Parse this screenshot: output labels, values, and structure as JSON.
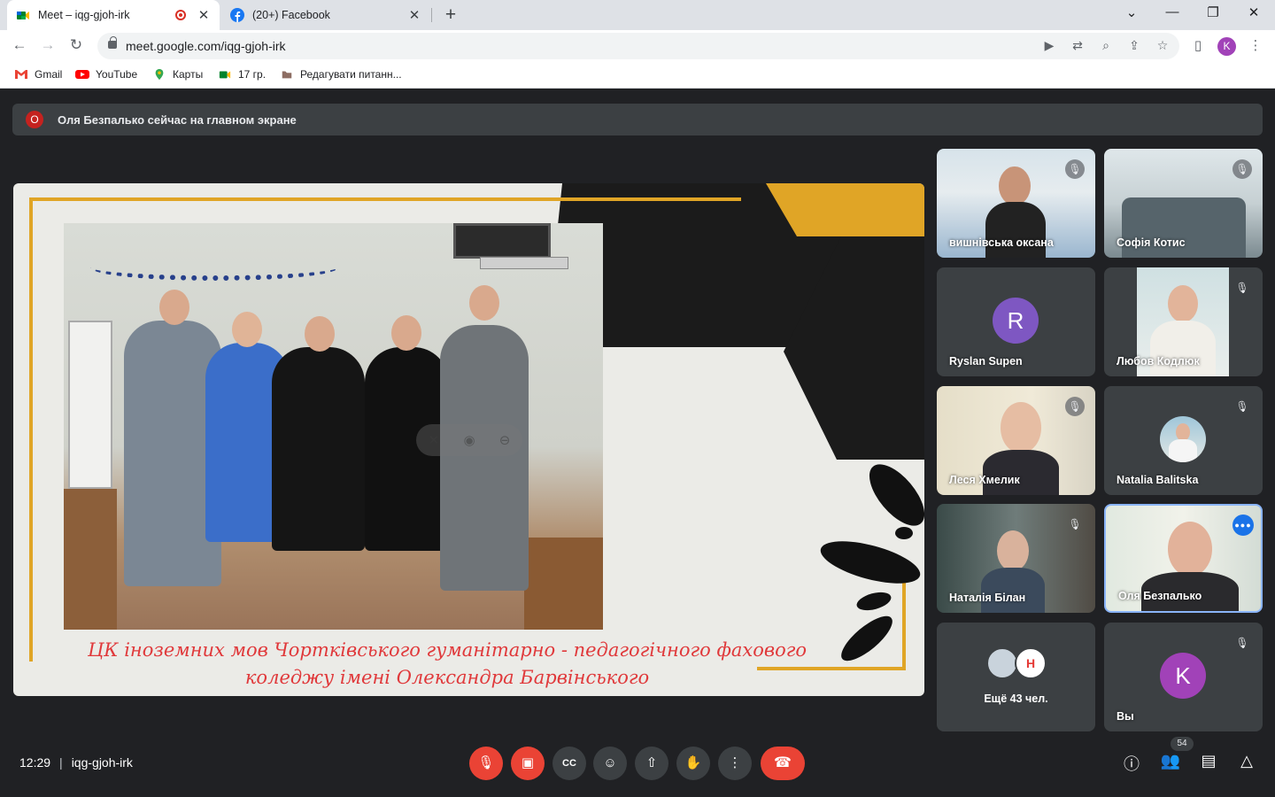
{
  "browser": {
    "tabs": [
      {
        "title": "Meet – iqg-gjoh-irk",
        "close": "✕"
      },
      {
        "title": "(20+) Facebook",
        "close": "✕"
      }
    ],
    "new_tab": "+",
    "window_controls": {
      "dropdown": "⌄",
      "minimize": "—",
      "restore": "❐",
      "close": "✕"
    },
    "url": "meet.google.com/iqg-gjoh-irk",
    "profile_letter": "K",
    "bookmarks": [
      {
        "label": "Gmail",
        "icon": "gmail-icon"
      },
      {
        "label": "YouTube",
        "icon": "youtube-icon"
      },
      {
        "label": "Карты",
        "icon": "maps-pin-icon"
      },
      {
        "label": "17 гр.",
        "icon": "meet-icon"
      },
      {
        "label": "Редагувати питанн...",
        "icon": "folder-icon"
      }
    ]
  },
  "meet": {
    "banner": {
      "initial": "О",
      "text": "Оля Безпалько сейчас на главном экране"
    },
    "presentation": {
      "caption_line1": "ЦК іноземних мов Чортківського гуманітарно - педагогічного фахового",
      "caption_line2": "коледжу імені Олександра Барвінського",
      "colors": {
        "accent_yellow": "#e0a526",
        "black": "#1b1b1b",
        "caption_red": "#e0393b"
      }
    },
    "participants": [
      {
        "name": "вишнівська оксана",
        "muted": true
      },
      {
        "name": "Софія Котис",
        "muted": true
      },
      {
        "name": "Ryslan Supen",
        "initial": "R",
        "avatar_color": "#7e57c2",
        "muted": false
      },
      {
        "name": "Любов Кодлюк",
        "muted": true
      },
      {
        "name": "Леся Хмелик",
        "muted": true
      },
      {
        "name": "Natalia Balitska",
        "muted": true
      },
      {
        "name": "Наталія Білан",
        "muted": true
      },
      {
        "name": "Оля Безпалько",
        "speaking": true
      },
      {
        "more_label": "Ещё 43 чел."
      },
      {
        "name": "Вы",
        "initial": "K",
        "avatar_color": "#a142b8",
        "muted": true
      }
    ],
    "bottom": {
      "time": "12:29",
      "separator": "|",
      "meeting_code": "iqg-gjoh-irk",
      "participant_count": "54"
    }
  }
}
